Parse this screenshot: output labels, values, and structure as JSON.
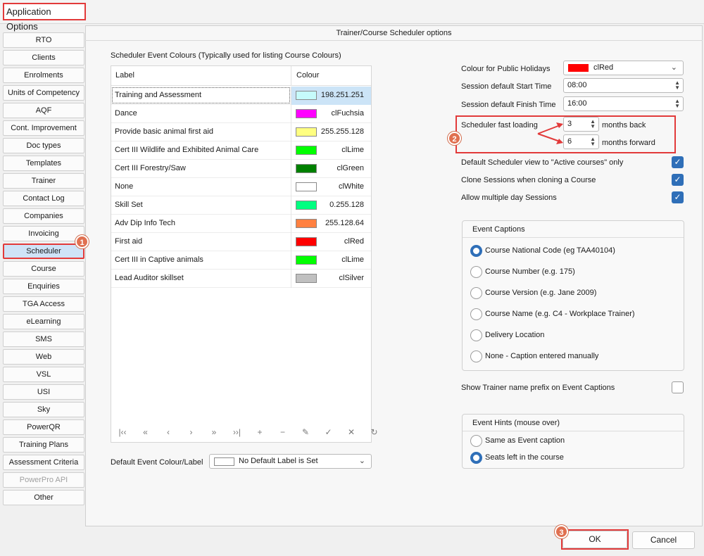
{
  "window": {
    "title": "Application Options"
  },
  "nav": {
    "items": [
      {
        "label": "RTO"
      },
      {
        "label": "Clients"
      },
      {
        "label": "Enrolments"
      },
      {
        "label": "Units of Competency"
      },
      {
        "label": "AQF"
      },
      {
        "label": "Cont. Improvement"
      },
      {
        "label": "Doc types"
      },
      {
        "label": "Templates"
      },
      {
        "label": "Trainer"
      },
      {
        "label": "Contact Log"
      },
      {
        "label": "Companies"
      },
      {
        "label": "Invoicing"
      },
      {
        "label": "Scheduler"
      },
      {
        "label": "Course"
      },
      {
        "label": "Enquiries"
      },
      {
        "label": "TGA Access"
      },
      {
        "label": "eLearning"
      },
      {
        "label": "SMS"
      },
      {
        "label": "Web"
      },
      {
        "label": "VSL"
      },
      {
        "label": "USI"
      },
      {
        "label": "Sky"
      },
      {
        "label": "PowerQR"
      },
      {
        "label": "Training Plans"
      },
      {
        "label": "Assessment Criteria"
      },
      {
        "label": "PowerPro API"
      },
      {
        "label": "Other"
      }
    ],
    "selected": "Scheduler",
    "disabled": "PowerPro API"
  },
  "panel": {
    "title": "Trainer/Course Scheduler options"
  },
  "colours_grid": {
    "heading": "Scheduler Event Colours (Typically used for listing Course Colours)",
    "col_label": "Label",
    "col_colour": "Colour",
    "rows": [
      {
        "label": "Training and Assessment",
        "colour_name": "198.251.251",
        "hex": "#c6fbfb"
      },
      {
        "label": "Dance",
        "colour_name": "clFuchsia",
        "hex": "#ff00ff"
      },
      {
        "label": "Provide basic animal first aid",
        "colour_name": "255.255.128",
        "hex": "#ffff80"
      },
      {
        "label": "Cert III Wildlife and Exhibited Animal Care",
        "colour_name": "clLime",
        "hex": "#00ff00"
      },
      {
        "label": "Cert III Forestry/Saw",
        "colour_name": "clGreen",
        "hex": "#008000"
      },
      {
        "label": "None",
        "colour_name": "clWhite",
        "hex": "#ffffff"
      },
      {
        "label": "Skill Set",
        "colour_name": "0.255.128",
        "hex": "#00ff80"
      },
      {
        "label": "Adv Dip Info Tech",
        "colour_name": "255.128.64",
        "hex": "#ff8040"
      },
      {
        "label": "First aid",
        "colour_name": "clRed",
        "hex": "#ff0000"
      },
      {
        "label": "Cert III in Captive animals",
        "colour_name": "clLime",
        "hex": "#00ff00"
      },
      {
        "label": "Lead Auditor skillset",
        "colour_name": "clSilver",
        "hex": "#c0c0c0"
      }
    ],
    "navigator": [
      "first-icon",
      "prior-page-icon",
      "prior-icon",
      "next-icon",
      "next-page-icon",
      "last-icon",
      "insert-icon",
      "delete-icon",
      "edit-icon",
      "post-icon",
      "cancel-icon",
      "refresh-icon"
    ]
  },
  "default_colour": {
    "label": "Default Event Colour/Label",
    "value": "No Default Label is Set"
  },
  "settings": {
    "public_holidays_label": "Colour for Public Holidays",
    "public_holidays_value": "clRed",
    "public_holidays_hex": "#ff0000",
    "start_time_label": "Session default Start Time",
    "start_time_value": "08:00",
    "finish_time_label": "Session default Finish Time",
    "finish_time_value": "16:00",
    "fast_loading_label": "Scheduler fast loading",
    "months_back_value": "3",
    "months_back_label": "months back",
    "months_forward_value": "6",
    "months_forward_label": "months forward",
    "active_courses_label": "Default Scheduler view to \"Active courses\" only",
    "clone_sessions_label": "Clone Sessions when cloning a Course",
    "multiple_day_label": "Allow multiple day Sessions",
    "trainer_prefix_label": "Show Trainer name prefix on Event Captions"
  },
  "event_captions": {
    "title": "Event Captions",
    "options": [
      {
        "label": "Course National Code (eg TAA40104)",
        "selected": true
      },
      {
        "label": "Course Number (e.g. 175)",
        "selected": false
      },
      {
        "label": "Course Version (e.g. Jane 2009)",
        "selected": false
      },
      {
        "label": "Course Name (e.g. C4 - Workplace Trainer)",
        "selected": false
      },
      {
        "label": "Delivery Location",
        "selected": false
      },
      {
        "label": "None - Caption entered manually",
        "selected": false
      }
    ]
  },
  "event_hints": {
    "title": "Event Hints (mouse over)",
    "options": [
      {
        "label": "Same as Event caption",
        "selected": false
      },
      {
        "label": "Seats left in the course",
        "selected": true
      }
    ]
  },
  "annotations": {
    "step1": "1",
    "step2": "2",
    "step3": "3"
  },
  "buttons": {
    "ok": "OK",
    "cancel": "Cancel"
  }
}
